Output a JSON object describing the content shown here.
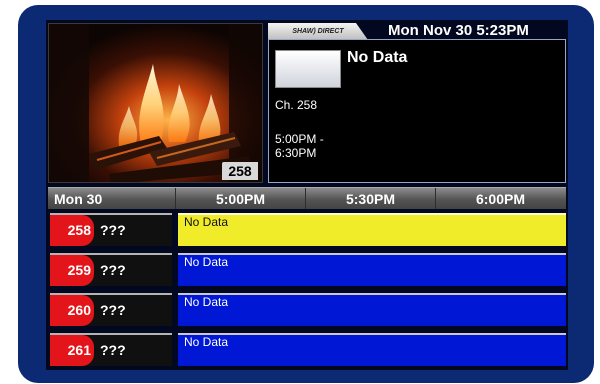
{
  "header": {
    "brand": "SHAW) DIRECT",
    "datetime": "Mon Nov 30 5:23PM"
  },
  "preview": {
    "channel_badge": "258",
    "image": "fireplace-flames"
  },
  "info": {
    "title": "No Data",
    "channel": "Ch. 258",
    "time_start": "5:00PM -",
    "time_end": "6:30PM"
  },
  "guide": {
    "date": "Mon 30",
    "slots": [
      "5:00PM",
      "5:30PM",
      "6:00PM"
    ],
    "rows": [
      {
        "number": "258",
        "name": "???",
        "program": "No Data",
        "selected": true
      },
      {
        "number": "259",
        "name": "???",
        "program": "No Data",
        "selected": false
      },
      {
        "number": "260",
        "name": "???",
        "program": "No Data",
        "selected": false
      },
      {
        "number": "261",
        "name": "???",
        "program": "No Data",
        "selected": false
      }
    ]
  },
  "colors": {
    "frame": "#0b2a73",
    "channel_red": "#e3141a",
    "program_blue": "#0017d6",
    "selected_yellow": "#f0ec2a"
  }
}
